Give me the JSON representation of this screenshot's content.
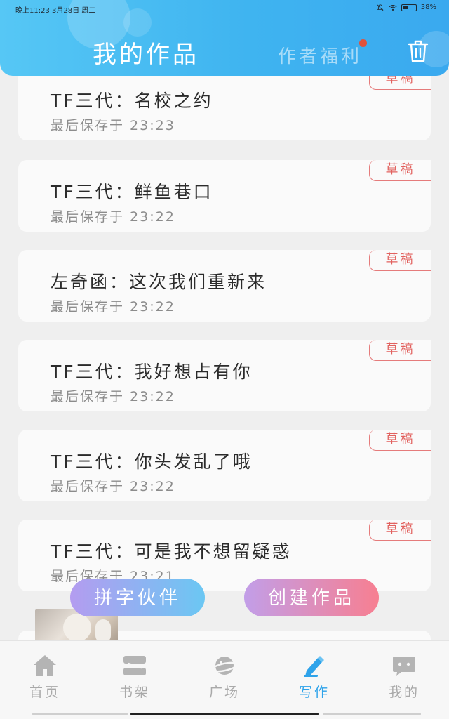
{
  "status_bar": {
    "time": "晚上11:23",
    "date": "3月28日 周二",
    "battery": "38%"
  },
  "header": {
    "title": "我的作品",
    "welfare": "作者福利",
    "trash_icon": "trash-icon"
  },
  "colors": {
    "header": "#3fb4f0",
    "draft_badge": "#e2625f",
    "active_nav": "#2ea3ea"
  },
  "works": [
    {
      "title": "TF三代：名校之约",
      "saved": "最后保存于 23:23",
      "badge": "草稿"
    },
    {
      "title": "TF三代：鲜鱼巷口",
      "saved": "最后保存于 23:22",
      "badge": "草稿"
    },
    {
      "title": "左奇函：这次我们重新来",
      "saved": "最后保存于 23:22",
      "badge": "草稿"
    },
    {
      "title": "TF三代：我好想占有你",
      "saved": "最后保存于 23:22",
      "badge": "草稿"
    },
    {
      "title": "TF三代：你头发乱了哦",
      "saved": "最后保存于 23:22",
      "badge": "草稿"
    },
    {
      "title": "TF三代：可是我不想留疑惑",
      "saved": "最后保存于 23:21",
      "badge": "草稿"
    }
  ],
  "actions": {
    "partner": "拼字伙伴",
    "create": "创建作品"
  },
  "nav": [
    {
      "label": "首页",
      "icon": "home-icon"
    },
    {
      "label": "书架",
      "icon": "bookshelf-icon"
    },
    {
      "label": "广场",
      "icon": "planet-icon"
    },
    {
      "label": "写作",
      "icon": "pen-icon",
      "active": true
    },
    {
      "label": "我的",
      "icon": "chat-bubble-icon"
    }
  ]
}
